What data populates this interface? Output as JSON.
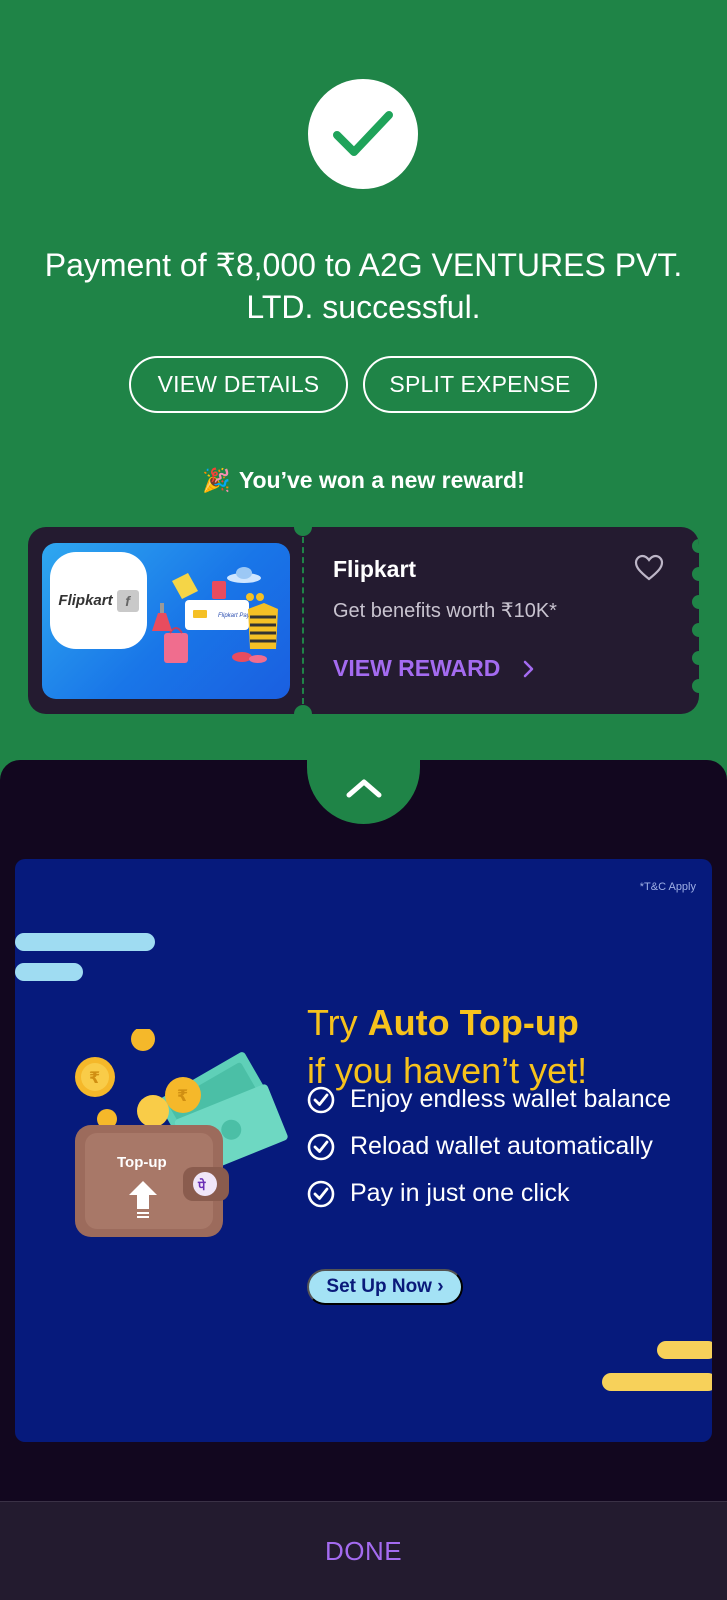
{
  "status": {
    "message": "Payment of ₹8,000 to A2G VENTURES PVT. LTD. successful.",
    "icon": "checkmark-icon"
  },
  "actions": {
    "view_details": "VIEW DETAILS",
    "split_expense": "SPLIT EXPENSE"
  },
  "reward": {
    "announcement": "You’ve won a new reward!",
    "brand": "Flipkart",
    "logo_text": "Flipkart",
    "art_text": "Flipkart Pay Later",
    "subtitle": "Get benefits worth ₹10K*",
    "cta": "VIEW REWARD"
  },
  "banner": {
    "tc": "*T&C Apply",
    "headline_pre": "Try ",
    "headline_bold": "Auto Top-up",
    "headline_line2": "if you haven’t yet!",
    "features": [
      "Enjoy endless wallet balance",
      "Reload wallet automatically",
      "Pay in just one click"
    ],
    "cta": "Set Up Now ›",
    "wallet_label": "Top-up",
    "coin_symbol": "₹",
    "wallet_badge": "पे"
  },
  "footer": {
    "done": "DONE"
  },
  "colors": {
    "success_green": "#1f8447",
    "accent_purple": "#a46bf0",
    "banner_blue": "#061a7c",
    "banner_yellow": "#f7c21c"
  }
}
